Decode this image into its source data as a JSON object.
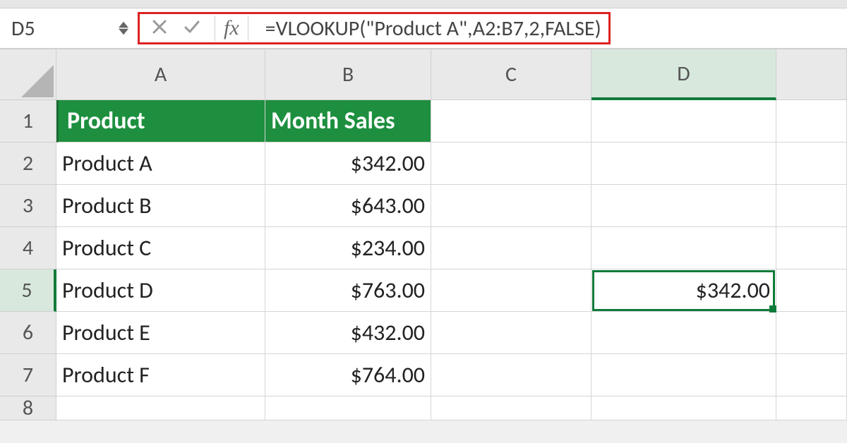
{
  "namebox": {
    "value": "D5"
  },
  "formula_bar": {
    "fx_label": "fx",
    "formula": "=VLOOKUP(\"Product A\",A2:B7,2,FALSE)"
  },
  "columns": [
    "A",
    "B",
    "C",
    "D"
  ],
  "rows": [
    "1",
    "2",
    "3",
    "4",
    "5",
    "6",
    "7",
    "8"
  ],
  "cells": {
    "A1": "Product",
    "B1": "Month Sales",
    "A2": "Product A",
    "B2": "$342.00",
    "A3": "Product B",
    "B3": "$643.00",
    "A4": "Product C",
    "B4": "$234.00",
    "A5": "Product D",
    "B5": "$763.00",
    "A6": "Product E",
    "B6": "$432.00",
    "A7": "Product F",
    "B7": "$764.00",
    "D5": "$342.00"
  },
  "active_cell": "D5",
  "chart_data": {
    "type": "table",
    "columns": [
      "Product",
      "Month Sales"
    ],
    "rows": [
      [
        "Product A",
        342.0
      ],
      [
        "Product B",
        643.0
      ],
      [
        "Product C",
        234.0
      ],
      [
        "Product D",
        763.0
      ],
      [
        "Product E",
        432.0
      ],
      [
        "Product F",
        764.0
      ]
    ]
  }
}
